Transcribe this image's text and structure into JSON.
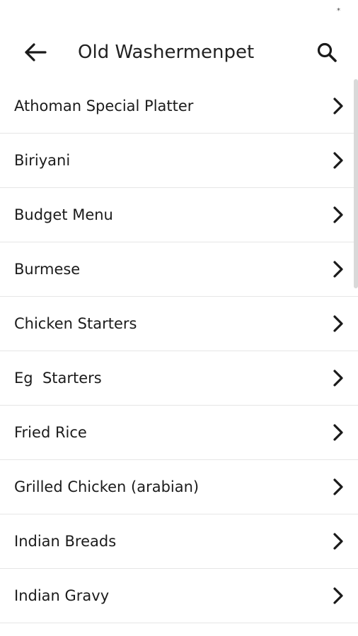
{
  "status_bar": {
    "indicator": "*"
  },
  "toolbar": {
    "back_icon": "arrow-left-icon",
    "title": "Old Washermenpet",
    "search_icon": "search-icon"
  },
  "categories": [
    {
      "label": "Athoman Special Platter"
    },
    {
      "label": "Biriyani"
    },
    {
      "label": "Budget Menu"
    },
    {
      "label": "Burmese"
    },
    {
      "label": "Chicken Starters"
    },
    {
      "label": "Eg  Starters"
    },
    {
      "label": "Fried Rice"
    },
    {
      "label": "Grilled Chicken (arabian)"
    },
    {
      "label": "Indian Breads"
    },
    {
      "label": "Indian Gravy"
    }
  ],
  "colors": {
    "background": "#ffffff",
    "text": "#1b1b1b",
    "divider": "#e6e6e6"
  }
}
